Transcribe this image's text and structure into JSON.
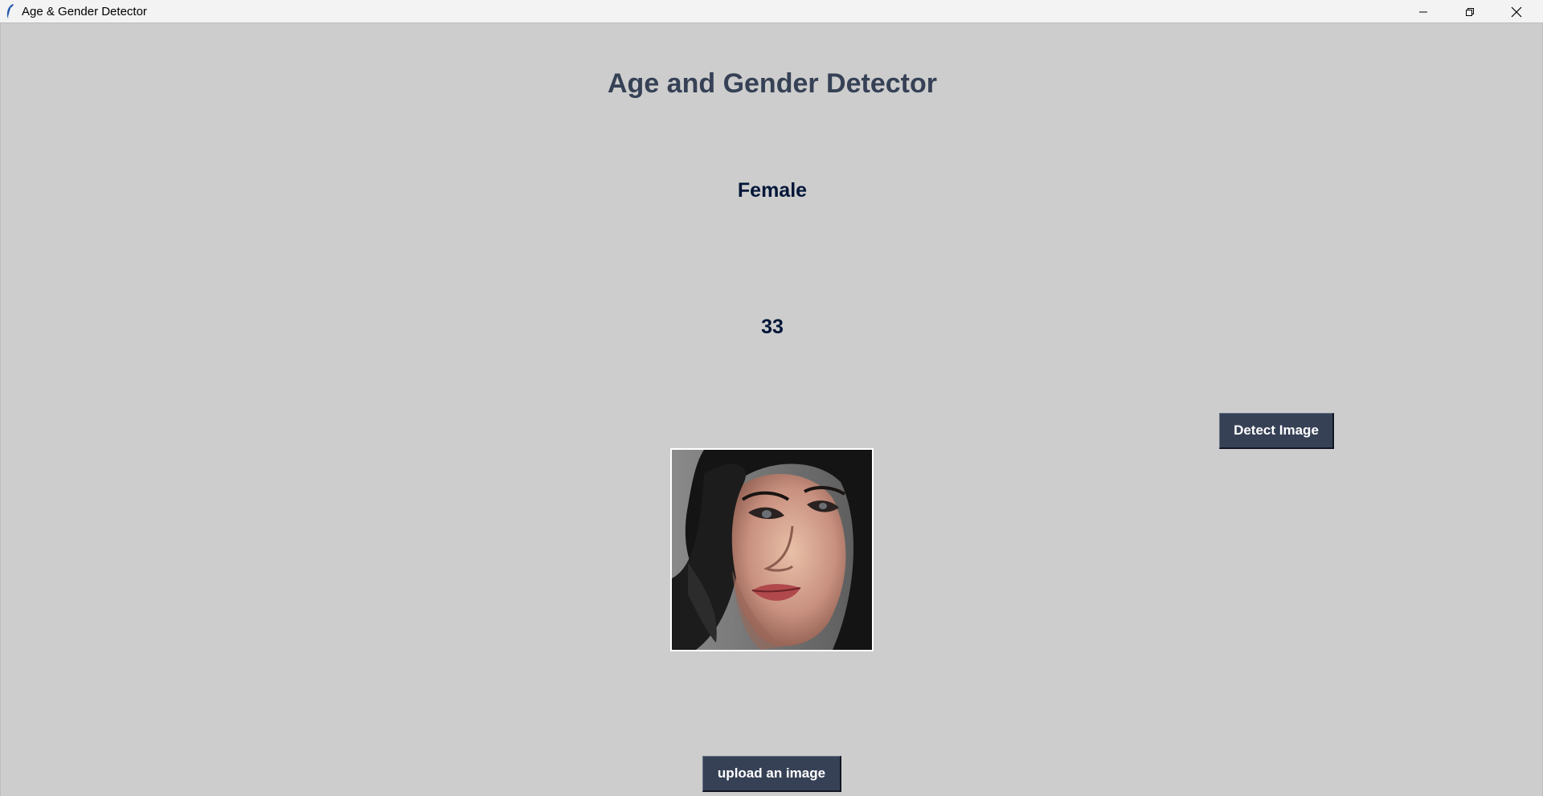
{
  "window": {
    "title": "Age & Gender Detector",
    "controls": {
      "minimize_icon": "minimize-icon",
      "maximize_icon": "restore-icon",
      "close_icon": "close-icon"
    }
  },
  "main": {
    "heading": "Age and Gender Detector",
    "gender_result": "Female",
    "age_result": "33",
    "detect_button_label": "Detect Image",
    "upload_button_label": "upload an image",
    "image": {
      "description_icon": "face-photo"
    }
  },
  "colors": {
    "background": "#cdcdcd",
    "heading": "#364156",
    "result_text": "#011638",
    "button_bg": "#364156",
    "button_text": "#ffffff"
  }
}
